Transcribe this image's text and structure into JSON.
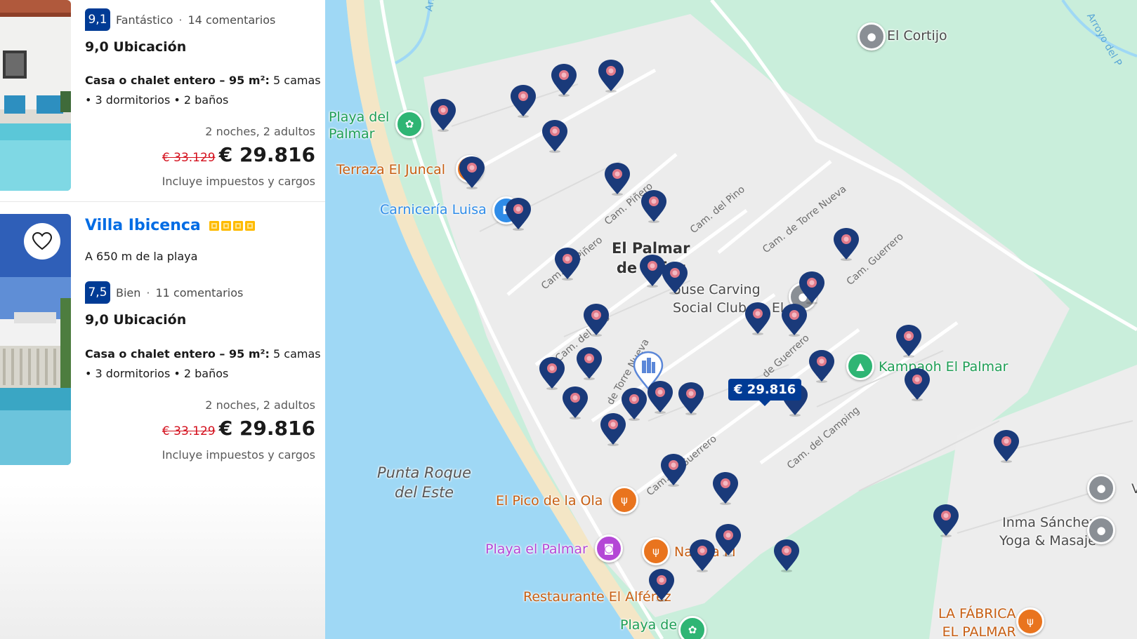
{
  "listings": [
    {
      "score": "9,1",
      "score_label": "Fantástico",
      "reviews": "14 comentarios",
      "location_score": "9,0 Ubicación",
      "type": "Casa o chalet entero – 95 m²:",
      "beds": "5 camas",
      "rooms": "• 3 dormitorios • 2 baños",
      "nights": "2 noches, 2 adultos",
      "old_price": "€ 33.129",
      "price": "€ 29.816",
      "taxes": "Incluye impuestos y cargos"
    },
    {
      "name": "Villa Ibicenca",
      "stars": 4,
      "distance": "A 650 m de la playa",
      "score": "7,5",
      "score_label": "Bien",
      "reviews": "11 comentarios",
      "location_score": "9,0 Ubicación",
      "type": "Casa o chalet entero – 95 m²:",
      "beds": "5 camas",
      "rooms": "• 3 dormitorios • 2 baños",
      "nights": "2 noches, 2 adultos",
      "old_price": "€ 33.129",
      "price": "€ 29.816",
      "taxes": "Incluye impuestos y cargos"
    }
  ],
  "map": {
    "town": "El Palmar\nde Vejer",
    "area": "Punta Roque\ndel Este",
    "selected_price": "€ 29.816",
    "places": {
      "el_cortijo": "El Cortijo",
      "playa_del_palmar": "Playa del\nPalmar",
      "terraza": "Terraza El Juncal",
      "carniceria": "Carnicería Luisa",
      "carving": "ouse Carving\nSocial Club en El...",
      "kampaoh": "Kampaoh El Palmar",
      "pico": "El Pico de la Ola",
      "playa_el_palmar": "Playa el Palmar",
      "natura": "Natura Pl",
      "alferez": "Restaurante El Alférez",
      "playa_de": "Playa de",
      "inma": "Inma Sánchez\nYoga & Masaje",
      "fabrica": "LA FÁBRICA,\nEL PALMAR",
      "v_cut": "V",
      "arroyo1": "Arroyo",
      "arroyo2": "Arroyo del P"
    },
    "streets": {
      "pino1": "Cam. del Pino",
      "pino2": "Cam. del Pino",
      "pinero": "Cam. De Piñero",
      "pinero2": "Cam. Piñero",
      "torre": "Cam. de Torre Nueva",
      "guerrero1": "Cam. Guerrero",
      "guerrero2": "de Guerrero",
      "guerrero3": "Cam. de Guerrero",
      "camping": "Cam. del Camping",
      "torre2": "de Torre Nueva"
    },
    "colors": {
      "water": "#9fd8f5",
      "land": "#c9eedb",
      "urban": "#ececec",
      "sand": "#f4e6c6",
      "pin": "#1a3a7a",
      "poi_orange": "#e9741e",
      "poi_green": "#2fb574",
      "poi_blue": "#2f8ce8",
      "poi_purple": "#b447d6",
      "poi_grey": "#8a8f95"
    }
  }
}
